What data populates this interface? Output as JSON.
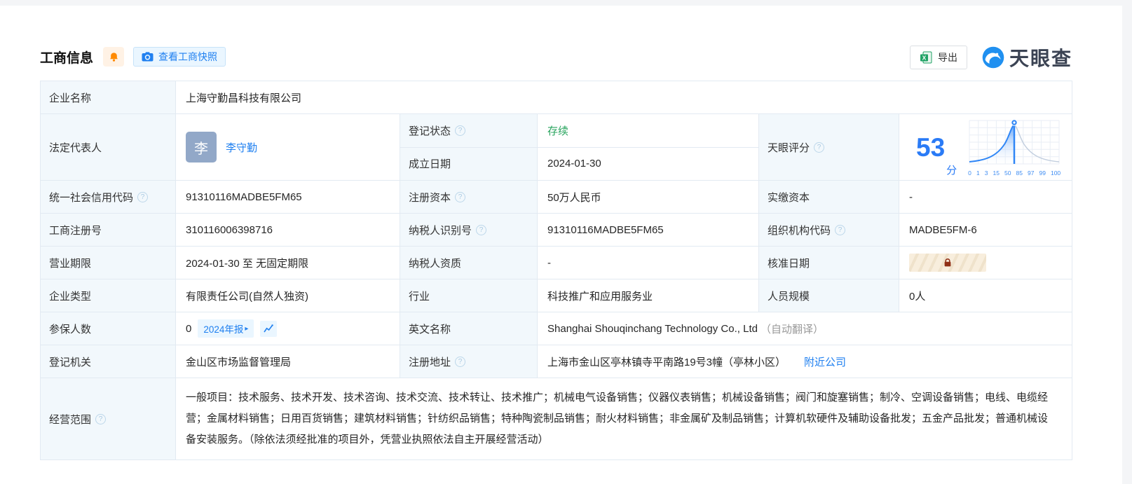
{
  "header": {
    "title": "工商信息",
    "snapshot_button": "查看工商快照",
    "export_button": "导出",
    "logo_text": "天眼查"
  },
  "colors": {
    "link_blue": "#2080f0",
    "status_green": "#28a45e",
    "score_blue": "#2a7bf6",
    "bell_orange": "#ff8a00",
    "excel_green": "#21a366",
    "brand_blue": "#2090f0",
    "lock_red": "#8f2f16",
    "label_cell_bg": "#f2f8fc"
  },
  "fields": {
    "company_name": {
      "label": "企业名称",
      "value": "上海守勤昌科技有限公司"
    },
    "legal_rep": {
      "label": "法定代表人",
      "avatar_char": "李",
      "name": "李守勤"
    },
    "reg_status": {
      "label": "登记状态",
      "value": "存续"
    },
    "establish_date": {
      "label": "成立日期",
      "value": "2024-01-30"
    },
    "tyc_score": {
      "label": "天眼评分",
      "score": "53",
      "unit": "分"
    },
    "credit_code": {
      "label": "统一社会信用代码",
      "value": "91310116MADBE5FM65"
    },
    "reg_capital": {
      "label": "注册资本",
      "value": "50万人民币"
    },
    "paid_capital": {
      "label": "实缴资本",
      "value": "-"
    },
    "reg_number": {
      "label": "工商注册号",
      "value": "310116006398716"
    },
    "taxpayer_id": {
      "label": "纳税人识别号",
      "value": "91310116MADBE5FM65"
    },
    "org_code": {
      "label": "组织机构代码",
      "value": "MADBE5FM-6"
    },
    "business_term": {
      "label": "营业期限",
      "value": "2024-01-30 至 无固定期限"
    },
    "taxpayer_quality": {
      "label": "纳税人资质",
      "value": "-"
    },
    "approval_date": {
      "label": "核准日期"
    },
    "company_type": {
      "label": "企业类型",
      "value": "有限责任公司(自然人独资)"
    },
    "industry": {
      "label": "行业",
      "value": "科技推广和应用服务业"
    },
    "staff_size": {
      "label": "人员规模",
      "value": "0人"
    },
    "insured_count": {
      "label": "参保人数",
      "value": "0",
      "report_link": "2024年报",
      "report_arrow": "▸"
    },
    "english_name": {
      "label": "英文名称",
      "value": "Shanghai Shouqinchang Technology Co., Ltd",
      "note": "（自动翻译）"
    },
    "reg_authority": {
      "label": "登记机关",
      "value": "金山区市场监督管理局"
    },
    "reg_address": {
      "label": "注册地址",
      "value": "上海市金山区亭林镇寺平南路19号3幢（亭林小区）",
      "nearby_link": "附近公司"
    },
    "business_scope": {
      "label": "经营范围",
      "value": "一般项目：技术服务、技术开发、技术咨询、技术交流、技术转让、技术推广；机械电气设备销售；仪器仪表销售；机械设备销售；阀门和旋塞销售；制冷、空调设备销售；电线、电缆经营；金属材料销售；日用百货销售；建筑材料销售；针纺织品销售；特种陶瓷制品销售；耐火材料销售；非金属矿及制品销售；计算机软硬件及辅助设备批发；五金产品批发；普通机械设备安装服务。（除依法须经批准的项目外，凭营业执照依法自主开展经营活动）"
    }
  },
  "score_chart": {
    "type": "area",
    "score": 53,
    "marker_tick": "50",
    "ticks": [
      "0",
      "1",
      "3",
      "15",
      "50",
      "85",
      "97",
      "99",
      "100"
    ]
  }
}
